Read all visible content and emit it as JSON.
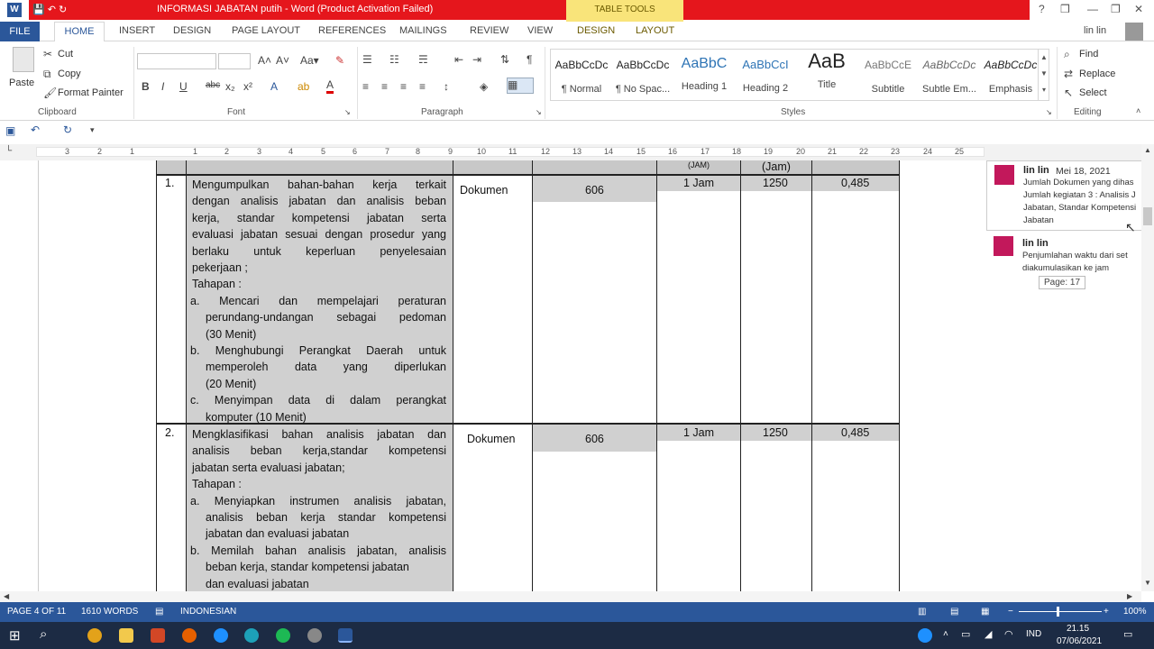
{
  "window": {
    "title": "INFORMASI JABATAN putih - Word (Product Activation Failed)",
    "table_tools": "TABLE TOOLS",
    "app_icon": "W",
    "qa_icons": "💾 ↶ ↻",
    "controls": [
      "?",
      "❒",
      "—",
      "❐",
      "✕"
    ]
  },
  "tabs": {
    "file": "FILE",
    "items": [
      "HOME",
      "INSERT",
      "DESIGN",
      "PAGE LAYOUT",
      "REFERENCES",
      "MAILINGS",
      "REVIEW",
      "VIEW",
      "DESIGN",
      "LAYOUT"
    ],
    "user": "lin lin"
  },
  "ribbon": {
    "clipboard": {
      "paste": "Paste",
      "cut": "Cut",
      "copy": "Copy",
      "format_painter": "Format Painter",
      "label": "Clipboard"
    },
    "font": {
      "label": "Font",
      "bold": "B",
      "italic": "I",
      "underline": "U",
      "strike": "abc",
      "sub": "x₂",
      "sup": "x²"
    },
    "paragraph": {
      "label": "Paragraph"
    },
    "styles": {
      "label": "Styles",
      "items": [
        {
          "sample": "AaBbCcDc",
          "name": "¶ Normal"
        },
        {
          "sample": "AaBbCcDc",
          "name": "¶ No Spac..."
        },
        {
          "sample": "AaBbC",
          "name": "Heading 1"
        },
        {
          "sample": "AaBbCcI",
          "name": "Heading 2"
        },
        {
          "sample": "AaB",
          "name": "Title"
        },
        {
          "sample": "AaBbCcE",
          "name": "Subtitle"
        },
        {
          "sample": "AaBbCcDc",
          "name": "Subtle Em..."
        },
        {
          "sample": "AaBbCcDc",
          "name": "Emphasis"
        }
      ]
    },
    "editing": {
      "label": "Editing",
      "find": "Find",
      "replace": "Replace",
      "select": "Select"
    }
  },
  "ruler": {
    "numbers": [
      "3",
      "2",
      "1",
      "1",
      "2",
      "3",
      "4",
      "5",
      "6",
      "7",
      "8",
      "9",
      "10",
      "11",
      "12",
      "13",
      "14",
      "15",
      "16",
      "17",
      "18",
      "19",
      "20",
      "21",
      "22",
      "23",
      "24",
      "25"
    ]
  },
  "document": {
    "header_fragments": [
      "(JAM)",
      "(Jam)"
    ],
    "rows": [
      {
        "no": "1.",
        "lines": [
          "Mengumpulkan bahan-bahan kerja terkait",
          "dengan analisis jabatan dan analisis beban",
          "kerja, standar kompetensi jabatan serta",
          "evaluasi jabatan sesuai dengan prosedur yang",
          "berlaku untuk keperluan penyelesaian",
          "pekerjaan ;",
          "Tahapan :",
          "a. Mencari dan mempelajari peraturan",
          "perundang-undangan sebagai pedoman",
          "(30 Menit)",
          "b. Menghubungi Perangkat Daerah untuk",
          "memperoleh data yang diperlukan",
          "(20 Menit)",
          "c. Menyimpan data di dalam perangkat",
          "komputer (10 Menit)"
        ],
        "unit": "Dokumen",
        "amount": "606",
        "time": "1 Jam",
        "effective": "1250",
        "need": "0,485"
      },
      {
        "no": "2.",
        "lines": [
          "Mengklasifikasi bahan analisis jabatan dan",
          "analisis beban kerja,standar kompetensi",
          "jabatan serta evaluasi jabatan;",
          "Tahapan :",
          "a. Menyiapkan instrumen analisis jabatan,",
          "analisis beban kerja standar kompetensi",
          "jabatan dan evaluasi jabatan",
          "b. Memilah bahan analisis jabatan, analisis",
          "beban kerja, standar kompetensi jabatan",
          "dan evaluasi jabatan"
        ],
        "unit": "Dokumen",
        "amount": "606",
        "time": "1 Jam",
        "effective": "1250",
        "need": "0,485"
      }
    ]
  },
  "comments": [
    {
      "author": "lin lin",
      "date": "Mei 18, 2021",
      "lines": [
        "Jumlah Dokumen yang dihas",
        "Jumlah kegiatan 3 : Analisis J",
        "Jabatan, Standar Kompetensi",
        "Jabatan"
      ]
    },
    {
      "author": "lin lin",
      "date": "",
      "lines": [
        "Penjumlahan waktu dari set",
        "diakumulasikan ke jam"
      ]
    }
  ],
  "page_tooltip": "Page: 17",
  "status": {
    "page": "PAGE 4 OF 11",
    "words": "1610 WORDS",
    "language": "INDONESIAN",
    "zoom": "100%"
  },
  "taskbar": {
    "time": "21.15",
    "date": "07/06/2021",
    "lang": "IND"
  }
}
